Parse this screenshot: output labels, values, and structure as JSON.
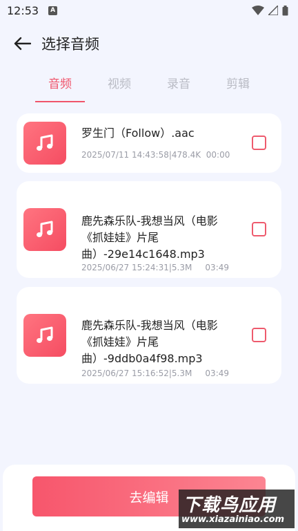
{
  "status_bar": {
    "time": "12:53",
    "indicator": "A"
  },
  "header": {
    "title": "选择音频",
    "back_icon": "arrow-left-icon"
  },
  "tabs": [
    {
      "label": "音频",
      "active": true
    },
    {
      "label": "视频",
      "active": false
    },
    {
      "label": "录音",
      "active": false
    },
    {
      "label": "剪辑",
      "active": false
    }
  ],
  "files": [
    {
      "name": "罗生门（Follow）.aac",
      "meta": "2025/07/11 14:43:58|478.4K  00:00",
      "icon": "music-note-icon",
      "checked": false
    },
    {
      "name": "鹿先森乐队-我想当风（电影《抓娃娃》片尾曲）-29e14c1648.mp3",
      "meta": "2025/06/27 15:24:31|5.3M     03:49",
      "icon": "music-note-icon",
      "checked": false
    },
    {
      "name": "鹿先森乐队-我想当风（电影《抓娃娃》片尾曲）-9ddb0a4f98.mp3",
      "meta": "2025/06/27 15:16:52|5.3M     03:49",
      "icon": "music-note-icon",
      "checked": false
    }
  ],
  "action": {
    "edit_label": "去编辑"
  },
  "watermark": {
    "title": "下载鸟应用",
    "url": "www.xiazainiao.com"
  },
  "colors": {
    "accent": "#f0546a",
    "background": "#f3f5fe",
    "tab_inactive": "#b9bbc4"
  }
}
